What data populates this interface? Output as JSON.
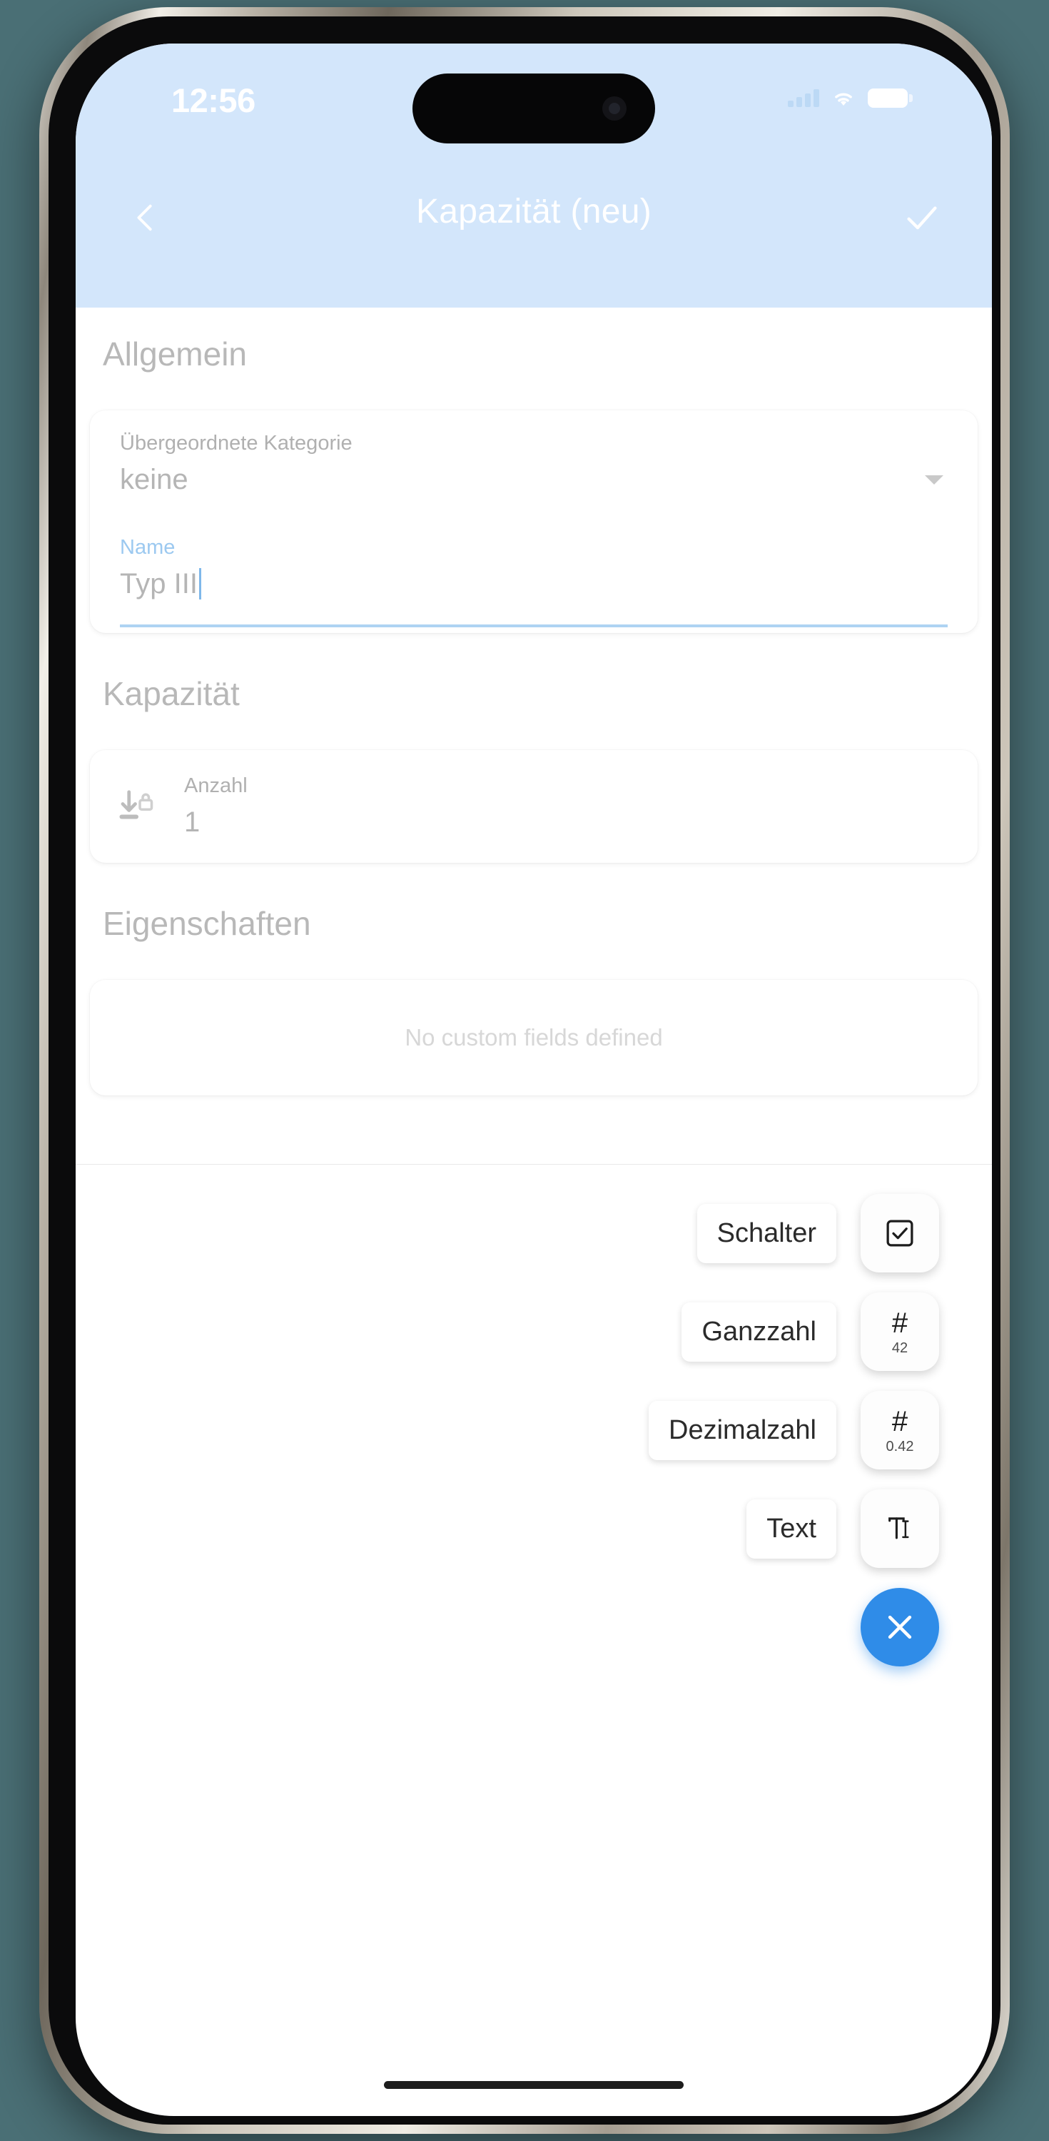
{
  "device": {
    "status_bar": {
      "time": "12:56",
      "signal_icon": "cellular-signal-icon",
      "wifi_icon": "wifi-icon",
      "battery_icon": "battery-icon"
    },
    "home_indicator": "home-indicator"
  },
  "nav": {
    "back_icon": "chevron-left-icon",
    "title": "Kapazität (neu)",
    "done_icon": "checkmark-icon"
  },
  "sections": [
    {
      "header": "Allgemein",
      "fields": [
        {
          "label": "Übergeordnete Kategorie",
          "value": "keine",
          "type": "dropdown",
          "icon": "chevron-down-icon"
        },
        {
          "label": "Name",
          "value": "Typ III",
          "type": "text",
          "focused": true
        }
      ]
    },
    {
      "header": "Kapazität",
      "fields": [
        {
          "label": "Anzahl",
          "value": "1",
          "type": "number",
          "icon": "move-to-bottom-lock-icon"
        }
      ]
    },
    {
      "header": "Eigenschaften",
      "empty_message": "No custom fields defined"
    }
  ],
  "speed_dial": {
    "items": [
      {
        "label": "Schalter",
        "icon": "checkbox-checked-icon",
        "glyph": "",
        "sub": ""
      },
      {
        "label": "Ganzzahl",
        "icon": "hash-icon",
        "glyph": "#",
        "sub": "42"
      },
      {
        "label": "Dezimalzahl",
        "icon": "hash-icon",
        "glyph": "#",
        "sub": "0.42"
      },
      {
        "label": "Text",
        "icon": "text-cursor-icon",
        "glyph": "",
        "sub": ""
      }
    ],
    "close_icon": "close-x-icon"
  },
  "colors": {
    "appbar": "#d3e6fb",
    "accent": "#2f8ce8",
    "field_accent": "#9cc9f0",
    "muted_text": "#b5b5b5",
    "section_header": "#b8b8b8"
  }
}
